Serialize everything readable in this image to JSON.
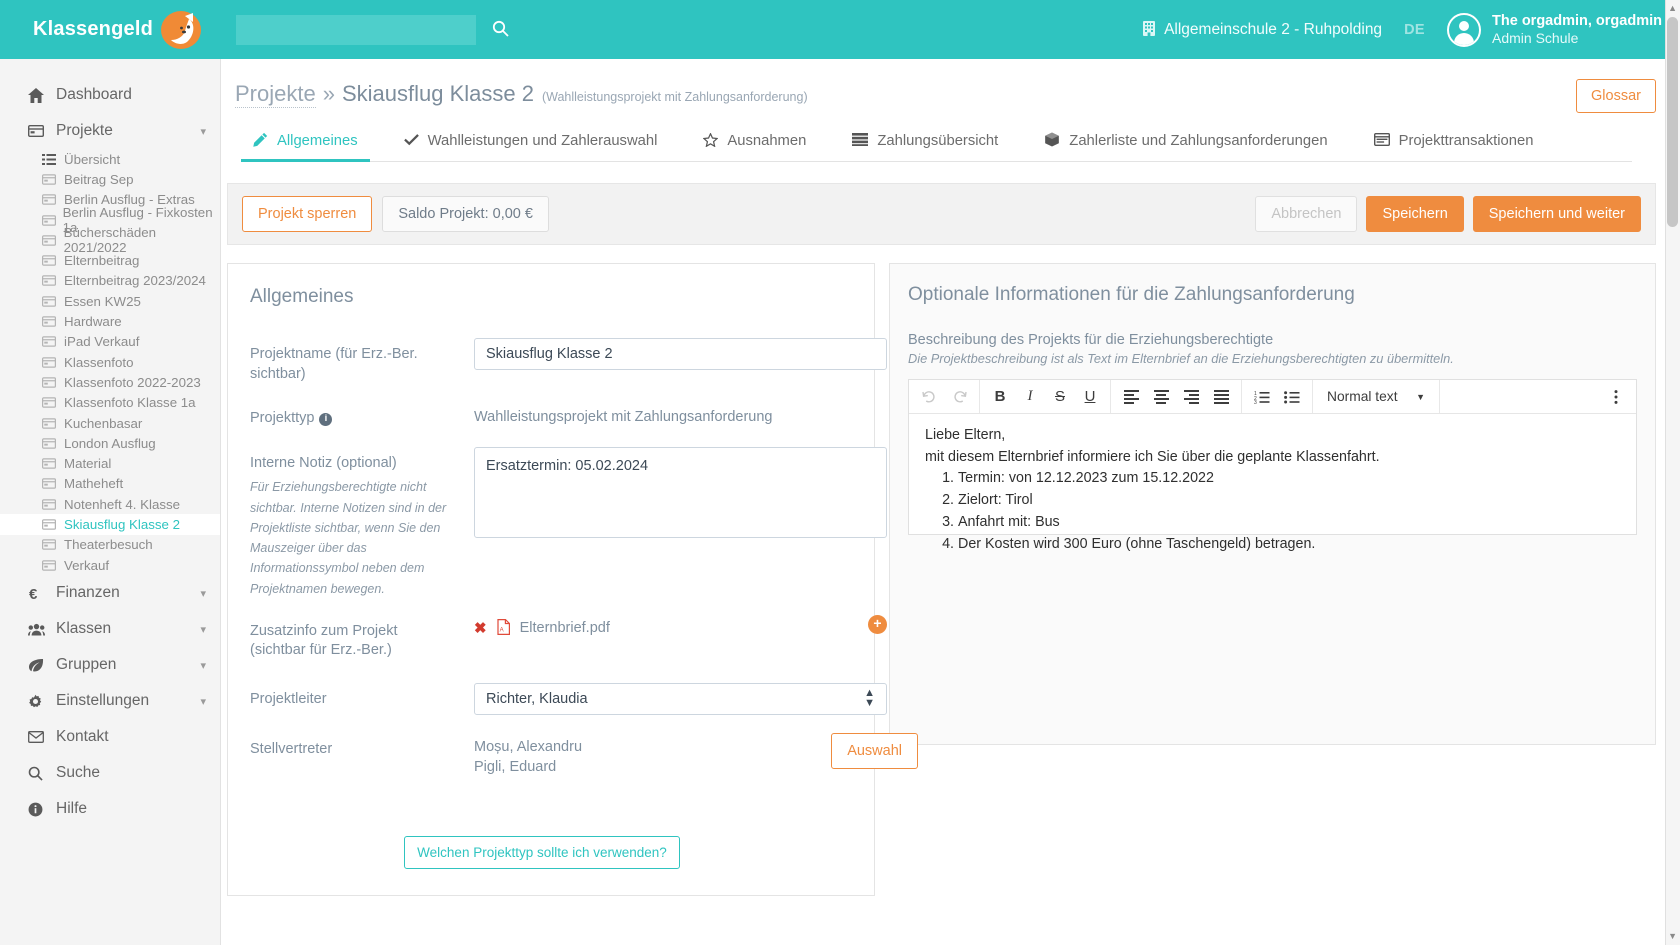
{
  "topbar": {
    "brand": "Klassengeld",
    "brand_icon": "fox-logo",
    "search_value": "",
    "search_placeholder": "",
    "search_icon": "search-icon",
    "school_icon": "building-icon",
    "school": "Allgemeinschule 2 - Ruhpolding",
    "language": "DE",
    "user_name": "The orgadmin, orgadmin",
    "user_role": "Admin Schule",
    "accent": "#2fc4c0"
  },
  "sidebar": {
    "items": [
      {
        "label": "Dashboard",
        "icon": "home-icon",
        "expandable": false
      },
      {
        "label": "Projekte",
        "icon": "card-icon",
        "expandable": true
      }
    ],
    "projekte_children": [
      {
        "label": "Übersicht",
        "icon": "list-icon",
        "active": false
      },
      {
        "label": "Beitrag Sep",
        "icon": "card-icon",
        "active": false
      },
      {
        "label": "Berlin Ausflug - Extras",
        "icon": "card-icon",
        "active": false
      },
      {
        "label": "Berlin Ausflug - Fixkosten 1a",
        "icon": "card-icon",
        "active": false
      },
      {
        "label": "Bücherschäden 2021/2022",
        "icon": "card-icon",
        "active": false
      },
      {
        "label": "Elternbeitrag",
        "icon": "card-icon",
        "active": false
      },
      {
        "label": "Elternbeitrag 2023/2024",
        "icon": "card-icon",
        "active": false
      },
      {
        "label": "Essen KW25",
        "icon": "card-icon",
        "active": false
      },
      {
        "label": "Hardware",
        "icon": "card-icon",
        "active": false
      },
      {
        "label": "iPad Verkauf",
        "icon": "card-icon",
        "active": false
      },
      {
        "label": "Klassenfoto",
        "icon": "card-icon",
        "active": false
      },
      {
        "label": "Klassenfoto 2022-2023",
        "icon": "card-icon",
        "active": false
      },
      {
        "label": "Klassenfoto Klasse 1a",
        "icon": "card-icon",
        "active": false
      },
      {
        "label": "Kuchenbasar",
        "icon": "card-icon",
        "active": false
      },
      {
        "label": "London Ausflug",
        "icon": "card-icon",
        "active": false
      },
      {
        "label": "Material",
        "icon": "card-icon",
        "active": false
      },
      {
        "label": "Matheheft",
        "icon": "card-icon",
        "active": false
      },
      {
        "label": "Notenheft 4. Klasse",
        "icon": "card-icon",
        "active": false
      },
      {
        "label": "Skiausflug Klasse 2",
        "icon": "card-icon",
        "active": true
      },
      {
        "label": "Theaterbesuch",
        "icon": "card-icon",
        "active": false
      },
      {
        "label": "Verkauf",
        "icon": "card-icon",
        "active": false
      }
    ],
    "bottom_items": [
      {
        "label": "Finanzen",
        "icon": "euro-icon",
        "expandable": true
      },
      {
        "label": "Klassen",
        "icon": "users-icon",
        "expandable": true
      },
      {
        "label": "Gruppen",
        "icon": "leaf-icon",
        "expandable": true
      },
      {
        "label": "Einstellungen",
        "icon": "gear-icon",
        "expandable": true
      },
      {
        "label": "Kontakt",
        "icon": "mail-icon",
        "expandable": false
      },
      {
        "label": "Suche",
        "icon": "search-icon",
        "expandable": false
      },
      {
        "label": "Hilfe",
        "icon": "info-icon",
        "expandable": false
      }
    ]
  },
  "page": {
    "breadcrumb_parent": "Projekte",
    "breadcrumb_sep": "»",
    "breadcrumb_title": "Skiausflug Klasse 2",
    "breadcrumb_subtitle": "(Wahlleistungsprojekt mit Zahlungsanforderung)",
    "glossar_label": "Glossar"
  },
  "tabs": [
    {
      "label": "Allgemeines",
      "icon": "pencil-icon",
      "active": true
    },
    {
      "label": "Wahlleistungen und Zahlerauswahl",
      "icon": "check-icon",
      "active": false
    },
    {
      "label": "Ausnahmen",
      "icon": "star-icon",
      "active": false
    },
    {
      "label": "Zahlungsübersicht",
      "icon": "rows-icon",
      "active": false
    },
    {
      "label": "Zahlerliste und Zahlungsanforderungen",
      "icon": "box-icon",
      "active": false
    },
    {
      "label": "Projekttransaktionen",
      "icon": "window-icon",
      "active": false
    }
  ],
  "toolbar": {
    "lock_project": "Projekt sperren",
    "balance": "Saldo Projekt: 0,00 €",
    "cancel": "Abbrechen",
    "save": "Speichern",
    "save_continue": "Speichern und weiter"
  },
  "form": {
    "card_title": "Allgemeines",
    "project_name_label": "Projektname (für Erz.-Ber. sichtbar)",
    "project_name_value": "Skiausflug Klasse 2",
    "project_type_label": "Projekttyp",
    "project_type_value": "Wahlleistungsprojekt mit Zahlungsanforderung",
    "internal_note_label": "Interne Notiz (optional)",
    "internal_note_hint": "Für Erziehungsberechtigte nicht sichtbar. Interne Notizen sind in der Projektliste sichtbar, wenn Sie den Mauszeiger über das Informationssymbol neben dem Projektnamen bewegen.",
    "internal_note_value": "Ersatztermin: 05.02.2024",
    "attachment_label_line1": "Zusatzinfo zum Projekt",
    "attachment_label_line2": "(sichtbar für Erz.-Ber.)",
    "attachment_file": "Elternbrief.pdf",
    "attachment_remove_icon": "remove-icon",
    "attachment_add_icon": "add-icon",
    "leader_label": "Projektleiter",
    "leader_value": "Richter, Klaudia",
    "leader_options": [
      "Richter, Klaudia"
    ],
    "deputy_label": "Stellvertreter",
    "deputy_names": [
      "Moșu, Alexandru",
      "Pigli, Eduard"
    ],
    "deputy_select_button": "Auswahl",
    "help_button": "Welchen Projekttyp sollte ich verwenden?"
  },
  "optional": {
    "title": "Optionale Informationen für die Zahlungsanforderung",
    "subtitle": "Beschreibung des Projekts für die Erziehungsberechtigte",
    "hint": "Die Projektbeschreibung ist als Text im Elternbrief an die Erziehungsberechtigten zu übermitteln.",
    "editor_toolbar": {
      "undo": "undo-icon",
      "redo": "redo-icon",
      "bold": "B",
      "italic": "I",
      "strike": "S",
      "underline": "U",
      "align_left": "align-left-icon",
      "align_center": "align-center-icon",
      "align_right": "align-right-icon",
      "align_justify": "align-justify-icon",
      "ordered_list": "ordered-list-icon",
      "bullet_list": "bullet-list-icon",
      "style_value": "Normal text",
      "more": "more-options-icon"
    },
    "editor_content": {
      "line1": "Liebe Eltern,",
      "line2": "mit diesem Elternbrief informiere ich Sie über die geplante Klassenfahrt.",
      "list": [
        "Termin: von 12.12.2023 zum 15.12.2022",
        "Zielort: Tirol",
        "Anfahrt mit: Bus",
        "Der Kosten wird 300 Euro (ohne Taschengeld) betragen."
      ]
    }
  }
}
